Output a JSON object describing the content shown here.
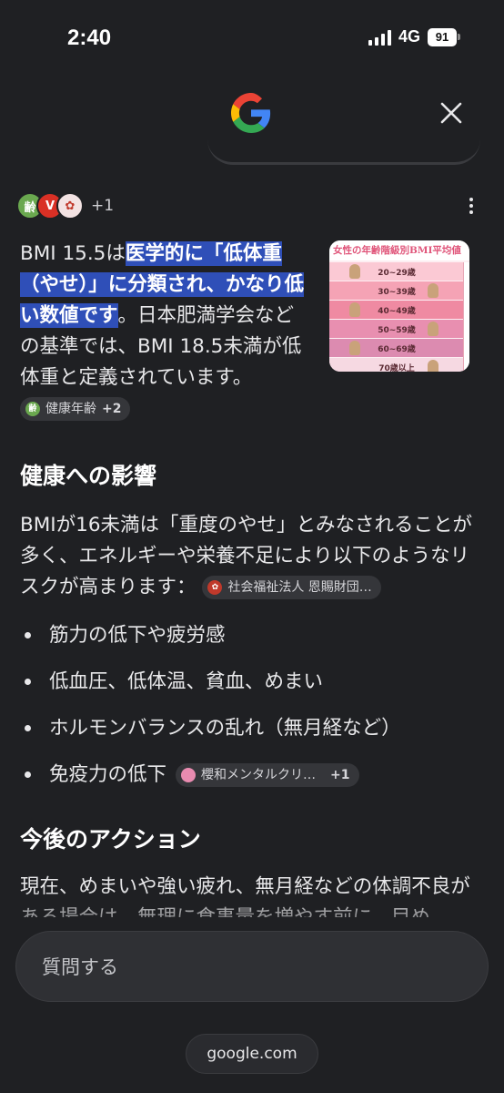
{
  "status_bar": {
    "time": "2:40",
    "network": "4G",
    "battery": "91"
  },
  "header": {
    "logo_icon": "google-g-icon",
    "close_icon": "close-icon"
  },
  "sources": {
    "more_label": "+1",
    "icons": [
      "health-age-favicon",
      "red-v-favicon",
      "seal-favicon"
    ]
  },
  "intro": {
    "lead": "BMI 15.5は",
    "highlight": "医学的に「低体重（やせ）」に分類され、かなり低い数値です",
    "rest": "。日本肥満学会などの基準では、BMI 18.5未満が低体重と定義されています。",
    "chip_label": "健康年齢",
    "chip_count": "+2"
  },
  "thumbnail": {
    "title": "女性の年齢階級別BMI平均値",
    "rows": [
      "20~29歳",
      "30~39歳",
      "40~49歳",
      "50~59歳",
      "60~69歳",
      "70歳以上"
    ],
    "row_colors": [
      "#fbc9d4",
      "#f5a3b5",
      "#ef8aa2",
      "#e88fb0",
      "#dc8bb0",
      "#f6d9e2"
    ]
  },
  "health_section": {
    "heading": "健康への影響",
    "body": "BMIが16未満は「重度のやせ」とみなされることが多く、エネルギーや栄養不足により以下のようなリスクが高まります：",
    "chip_label": "社会福祉法人 恩賜財団…",
    "bullets": [
      "筋力の低下や疲労感",
      "低血圧、低体温、貧血、めまい",
      "ホルモンバランスの乱れ（無月経など）",
      "免疫力の低下"
    ],
    "last_chip_label": "櫻和メンタルクリ…",
    "last_chip_count": "+1"
  },
  "action_section": {
    "heading": "今後のアクション",
    "body": "現在、めまいや強い疲れ、無月経などの体調不良がある場合は、無理に食事量を増やす前に、目め"
  },
  "ask": {
    "placeholder": "質問する"
  },
  "footer": {
    "url": "google.com"
  },
  "colors": {
    "background": "#1f2023",
    "highlight": "#2f4fb8",
    "chip_bg": "#35363a"
  }
}
